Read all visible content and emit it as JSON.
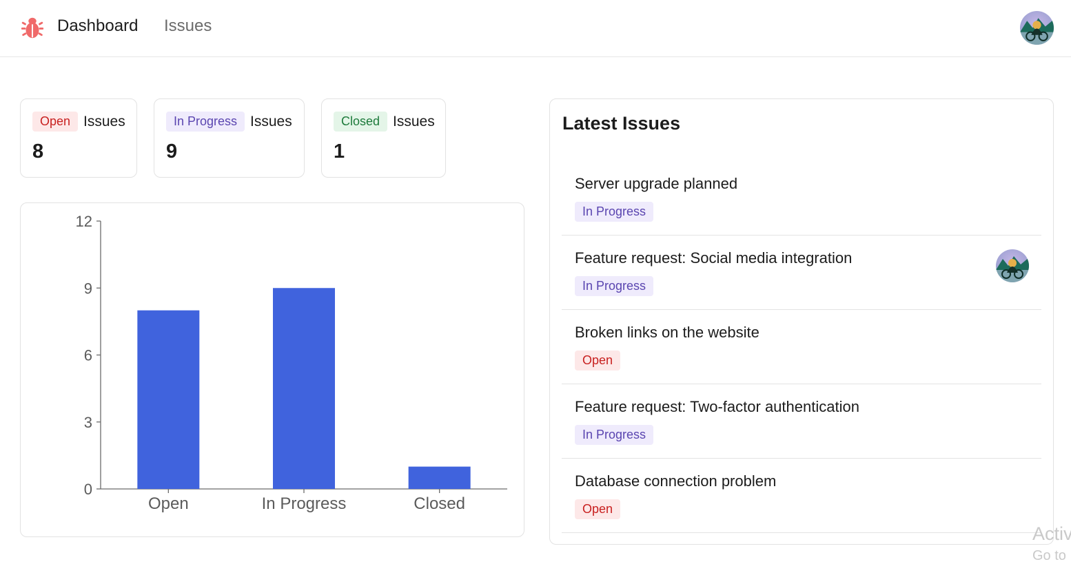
{
  "nav": {
    "dashboard_label": "Dashboard",
    "issues_label": "Issues"
  },
  "stats": [
    {
      "status": "Open",
      "label": "Issues",
      "count": "8",
      "color": "#c8201f"
    },
    {
      "status": "In Progress",
      "label": "Issues",
      "count": "9",
      "color": "#5a45b0"
    },
    {
      "status": "Closed",
      "label": "Issues",
      "count": "1",
      "color": "#1d7a3b"
    }
  ],
  "chart_data": {
    "type": "bar",
    "categories": [
      "Open",
      "In Progress",
      "Closed"
    ],
    "values": [
      8,
      9,
      1
    ],
    "ylim": [
      0,
      12
    ],
    "yticks": [
      0,
      3,
      6,
      9,
      12
    ],
    "grid": false,
    "bar_color": "#4063dd"
  },
  "latest": {
    "title": "Latest Issues",
    "issues": [
      {
        "title": "Server upgrade planned",
        "status": "In Progress",
        "assignee": false
      },
      {
        "title": "Feature request: Social media integration",
        "status": "In Progress",
        "assignee": true
      },
      {
        "title": "Broken links on the website",
        "status": "Open",
        "assignee": false
      },
      {
        "title": "Feature request: Two-factor authentication",
        "status": "In Progress",
        "assignee": false
      },
      {
        "title": "Database connection problem",
        "status": "Open",
        "assignee": false
      }
    ]
  },
  "watermark": {
    "line1": "Activ",
    "line2": "Go to"
  }
}
